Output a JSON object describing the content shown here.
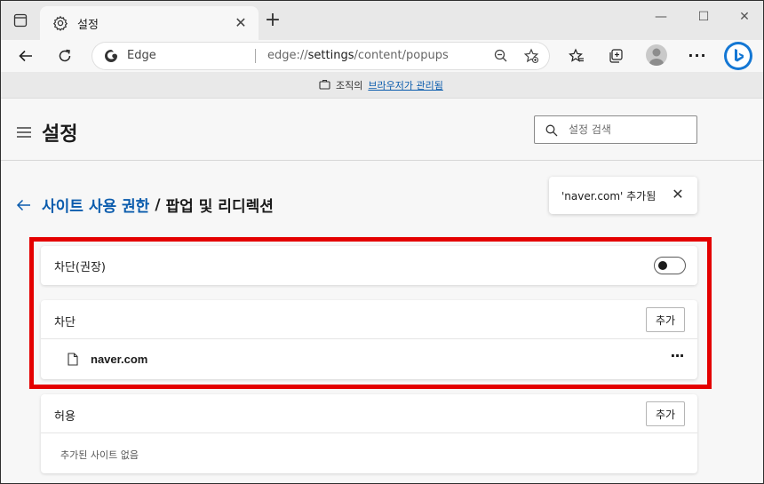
{
  "browser": {
    "tab_title": "설정",
    "edge_label": "Edge",
    "url_prefix": "edge://",
    "url_host": "settings",
    "url_path": "/content/popups"
  },
  "banner": {
    "prefix": "조직의",
    "link": "브라우저가 관리됨"
  },
  "header": {
    "title": "설정",
    "search_placeholder": "설정 검색"
  },
  "breadcrumb": {
    "parent": "사이트 사용 권한",
    "separator": "/",
    "current": "팝업 및 리디렉션"
  },
  "toast": {
    "message": "'naver.com' 추가됨"
  },
  "block_recommended": {
    "label": "차단(권장)",
    "enabled": false
  },
  "block_section": {
    "title": "차단",
    "add_label": "추가",
    "sites": [
      "naver.com"
    ]
  },
  "allow_section": {
    "title": "허용",
    "add_label": "추가",
    "empty_text": "추가된 사이트 없음"
  },
  "colors": {
    "accent": "#0b5cad",
    "highlight": "#e40000",
    "edge_blue": "#1477d4"
  }
}
